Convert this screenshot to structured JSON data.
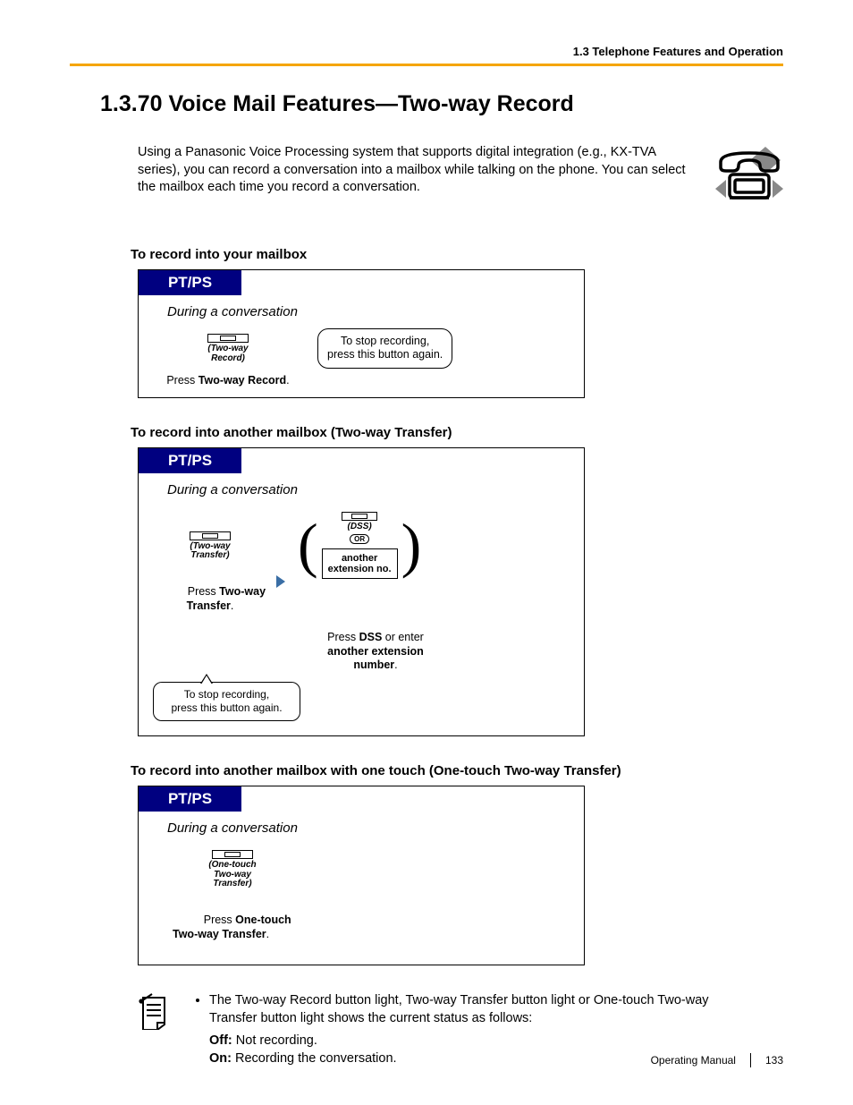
{
  "header": {
    "breadcrumb": "1.3 Telephone Features and Operation"
  },
  "title": "1.3.70  Voice Mail Features—Two-way Record",
  "intro": "Using a Panasonic Voice Processing system that supports digital integration (e.g., KX-TVA series), you can record a conversation into a mailbox while talking on the phone. You can select the mailbox each time you record a conversation.",
  "sections": {
    "s1": {
      "heading": "To record into your mailbox",
      "tab": "PT/PS",
      "context": "During a conversation",
      "button_label": "(Two-way\nRecord)",
      "note": "To stop recording,\npress this button again.",
      "caption_pre": "Press ",
      "caption_bold": "Two-way Record",
      "caption_post": "."
    },
    "s2": {
      "heading": "To record into another mailbox (Two-way Transfer)",
      "tab": "PT/PS",
      "context": "During a conversation",
      "button_label": "(Two-way\nTransfer)",
      "dss_label": "(DSS)",
      "or_label": "OR",
      "inner_box": "another\nextension no.",
      "caption1_pre": "Press ",
      "caption1_bold": "Two-way\nTransfer",
      "caption1_post": ".",
      "caption2_pre": "Press ",
      "caption2_b1": "DSS",
      "caption2_mid": " or enter ",
      "caption2_b2": "another extension number",
      "caption2_post": ".",
      "callout": "To stop recording,\npress this button again."
    },
    "s3": {
      "heading": "To record into another mailbox with one touch (One-touch Two-way Transfer)",
      "tab": "PT/PS",
      "context": "During a conversation",
      "button_label": "(One-touch\nTwo-way\nTransfer)",
      "caption_pre": "Press ",
      "caption_bold": "One-touch\nTwo-way Transfer",
      "caption_post": "."
    }
  },
  "notes": {
    "bullet": "The Two-way Record button light, Two-way Transfer button light or One-touch Two-way Transfer button light shows the current status as follows:",
    "off_label": "Off:",
    "off_text": " Not recording.",
    "on_label": "On:",
    "on_text": " Recording the conversation."
  },
  "footer": {
    "manual": "Operating Manual",
    "page": "133"
  }
}
